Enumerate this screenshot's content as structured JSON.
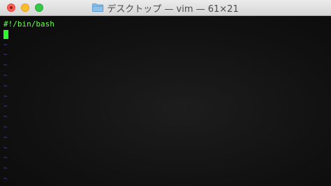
{
  "window": {
    "title": "デスクトップ — vim — 61×21"
  },
  "icons": {
    "title_icon": "folder-icon"
  },
  "colors": {
    "text_green": "#6aff4e",
    "cursor": "#28ff28",
    "tilde": "#6b38d6"
  },
  "editor": {
    "line1": "#!/bin/bash",
    "line2": "",
    "tilde": "~"
  }
}
